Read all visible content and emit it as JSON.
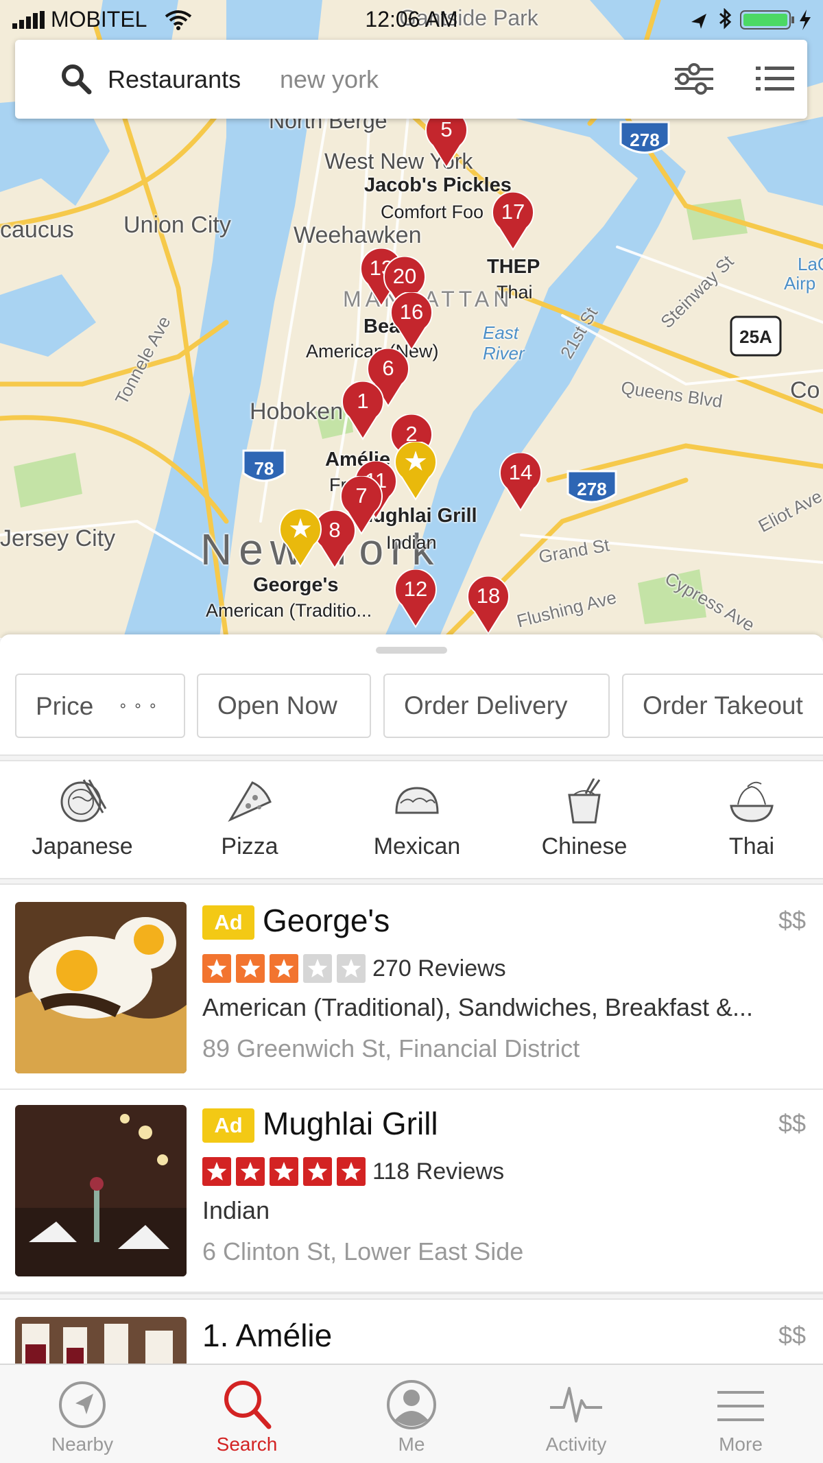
{
  "status_bar": {
    "carrier": "MOBITEL",
    "time": "12:06 AM"
  },
  "search": {
    "query": "Restaurants",
    "location": "new york"
  },
  "map": {
    "labels": [
      "North Berge",
      "West New York",
      "Union City",
      "caucus",
      "Weehawken",
      "MANHATTAN",
      "Hoboken",
      "Jersey City",
      "New York",
      "Queens Blvd",
      "Co",
      "LaG",
      "Airp",
      "Tonnele Ave",
      "21st St",
      "Steinway St",
      "Grand St",
      "Flushing Ave",
      "Cypress Ave",
      "Eliot Ave",
      "East River",
      "Gantside Park"
    ],
    "shields": [
      "278",
      "278",
      "78",
      "25A"
    ],
    "pois": [
      {
        "name": "Jacob's Pickles",
        "category": "Comfort Foo"
      },
      {
        "name": "THEP",
        "category": "Thai"
      },
      {
        "name": "Bea",
        "category": "American (New)"
      },
      {
        "name": "Amélie",
        "category": "Fr"
      },
      {
        "name": "Mughlai Grill",
        "category": "Indian"
      },
      {
        "name": "George's",
        "category": "American (Traditio..."
      }
    ],
    "pins": [
      "5",
      "17",
      "13",
      "20",
      "16",
      "6",
      "1",
      "2",
      "11",
      "7",
      "8",
      "14",
      "12",
      "18"
    ]
  },
  "filters": [
    {
      "label": "Price",
      "dots": "∘∘∘"
    },
    {
      "label": "Open Now"
    },
    {
      "label": "Order Delivery"
    },
    {
      "label": "Order Takeout"
    }
  ],
  "categories": [
    "Japanese",
    "Pizza",
    "Mexican",
    "Chinese",
    "Thai"
  ],
  "results": [
    {
      "ad": "Ad",
      "name": "George's",
      "price": "$$",
      "rating": 3,
      "reviews": "270 Reviews",
      "categories": "American (Traditional), Sandwiches, Breakfast &...",
      "address": "89 Greenwich St, Financial District",
      "star_color": "#f2742f"
    },
    {
      "ad": "Ad",
      "name": "Mughlai Grill",
      "price": "$$",
      "rating": 5,
      "reviews": "118 Reviews",
      "categories": "Indian",
      "address": "6 Clinton St, Lower East Side",
      "star_color": "#d32323"
    },
    {
      "name": "1. Amélie",
      "price": "$$"
    }
  ],
  "tabs": [
    {
      "label": "Nearby",
      "icon": "compass-icon"
    },
    {
      "label": "Search",
      "icon": "search-icon"
    },
    {
      "label": "Me",
      "icon": "person-icon"
    },
    {
      "label": "Activity",
      "icon": "pulse-icon"
    },
    {
      "label": "More",
      "icon": "menu-icon"
    }
  ],
  "colors": {
    "brand_red": "#d32323",
    "ad_yellow": "#f3c915",
    "pin_red": "#c4262d",
    "pin_gold": "#e9b90c"
  }
}
